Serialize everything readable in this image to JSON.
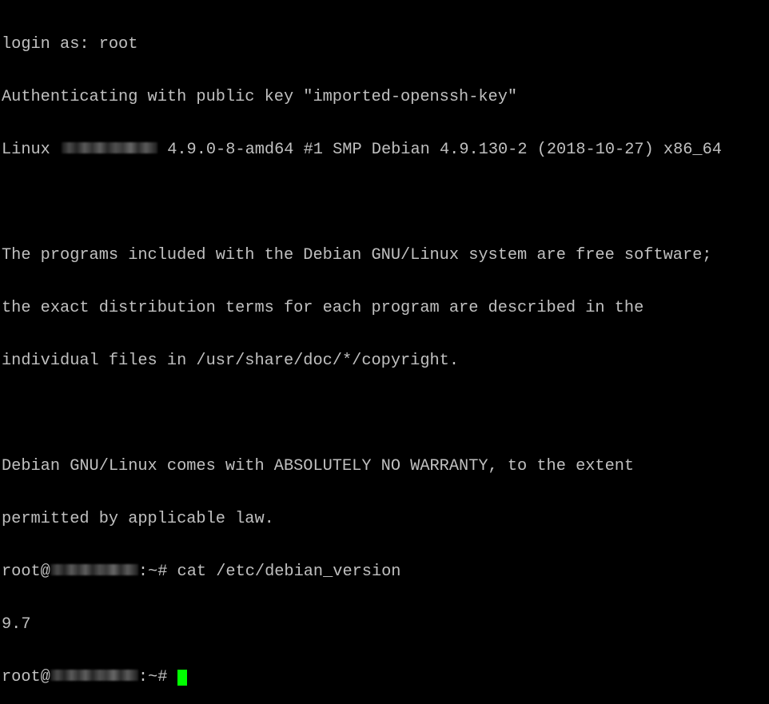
{
  "terminal": {
    "background": "#000000",
    "foreground": "#c0c0c0",
    "cursor_color": "#00ff00",
    "lines": {
      "l0": "login as: root",
      "l1": "Authenticating with public key \"imported-openssh-key\"",
      "l2_prefix": "Linux ",
      "l2_suffix": " 4.9.0-8-amd64 #1 SMP Debian 4.9.130-2 (2018-10-27) x86_64",
      "l3": "",
      "l4": "The programs included with the Debian GNU/Linux system are free software;",
      "l5": "the exact distribution terms for each program are described in the",
      "l6": "individual files in /usr/share/doc/*/copyright.",
      "l7": "",
      "l8": "Debian GNU/Linux comes with ABSOLUTELY NO WARRANTY, to the extent",
      "l9": "permitted by applicable law.",
      "l10_prompt_user": "root@",
      "l10_prompt_suffix": ":~# ",
      "l10_command": "cat /etc/debian_version",
      "l11": "9.7",
      "l12_prompt_user": "root@",
      "l12_prompt_suffix": ":~# "
    },
    "hostname_redacted": true
  }
}
